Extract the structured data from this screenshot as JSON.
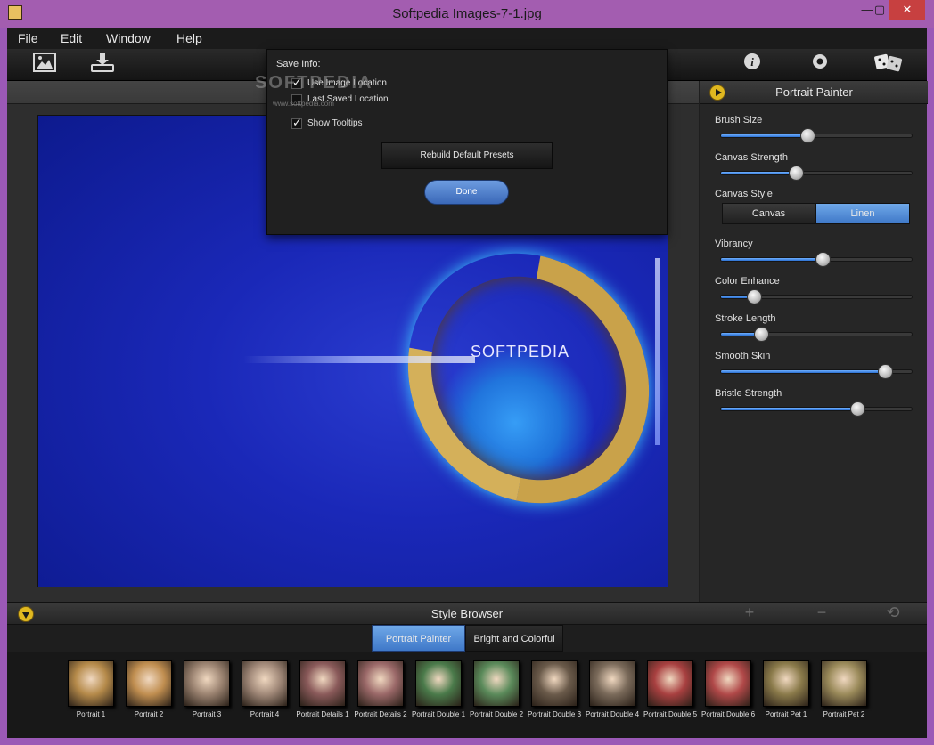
{
  "window": {
    "title": "Softpedia Images-7-1.jpg",
    "minimize": "—",
    "maximize": "▢",
    "close": "✕"
  },
  "menu": [
    "File",
    "Edit",
    "Window",
    "Help"
  ],
  "toolbar": {
    "left_icons": [
      "image-icon",
      "download-icon"
    ],
    "right_icons": [
      "info-icon",
      "settings-icon",
      "dice-icon"
    ]
  },
  "canvas": {
    "overlay_text": "SOFTPEDIA"
  },
  "popup": {
    "label": "Save Info:",
    "options": [
      {
        "label": "Use Image Location",
        "checked": true
      },
      {
        "label": "Last Saved Location",
        "checked": false
      },
      {
        "label": "Show Tooltips",
        "checked": true
      }
    ],
    "rebuild_button": "Rebuild Default Presets",
    "done_button": "Done",
    "watermark": "SOFTPEDIA",
    "watermark_url": "www.softpedia.com"
  },
  "panel": {
    "title": "Portrait Painter",
    "params": [
      {
        "label": "Brush Size",
        "value": 0.45
      },
      {
        "label": "Canvas Strength",
        "value": 0.39
      },
      {
        "label": "Vibrancy",
        "value": 0.53
      },
      {
        "label": "Color Enhance",
        "value": 0.17
      },
      {
        "label": "Stroke Length",
        "value": 0.21
      },
      {
        "label": "Smooth Skin",
        "value": 0.85
      },
      {
        "label": "Bristle Strength",
        "value": 0.71
      }
    ],
    "canvas_style": {
      "label": "Canvas Style",
      "options": [
        "Canvas",
        "Linen"
      ],
      "selected": "Linen"
    }
  },
  "style_browser": {
    "title": "Style Browser",
    "tools": [
      "+",
      "−",
      "⟲"
    ],
    "tabs": [
      "Portrait Painter",
      "Bright and Colorful"
    ],
    "active_tab": "Portrait Painter",
    "thumbs": [
      {
        "label": "Portrait 1",
        "color": "#b58a4a"
      },
      {
        "label": "Portrait 2",
        "color": "#c08e50"
      },
      {
        "label": "Portrait 3",
        "color": "#9a8270"
      },
      {
        "label": "Portrait 4",
        "color": "#a08878"
      },
      {
        "label": "Portrait Details 1",
        "color": "#8a5a5a"
      },
      {
        "label": "Portrait Details 2",
        "color": "#9a6868"
      },
      {
        "label": "Portrait Double 1",
        "color": "#4a7a4a"
      },
      {
        "label": "Portrait Double 2",
        "color": "#5a8a5a"
      },
      {
        "label": "Portrait Double 3",
        "color": "#6a5a4a"
      },
      {
        "label": "Portrait Double 4",
        "color": "#7a6a5a"
      },
      {
        "label": "Portrait Double 5",
        "color": "#a84040"
      },
      {
        "label": "Portrait Double 6",
        "color": "#b04848"
      },
      {
        "label": "Portrait Pet 1",
        "color": "#8a7a4a"
      },
      {
        "label": "Portrait Pet 2",
        "color": "#9a8a5a"
      }
    ]
  }
}
